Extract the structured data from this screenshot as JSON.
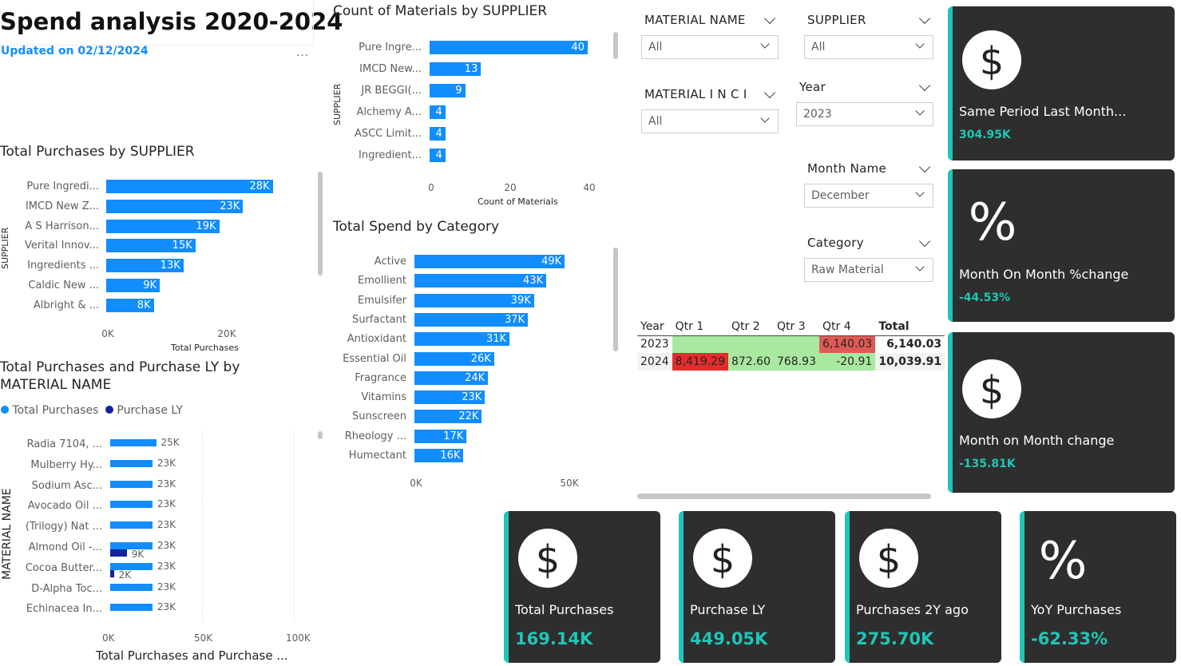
{
  "header": {
    "title": "Spend analysis 2020-2024",
    "updated": "Updated on 02/12/2024",
    "more": "..."
  },
  "count_materials": {
    "title": "Count of Materials by SUPPLIER",
    "y_title": "SUPPLIER",
    "x_title": "Count of Materials",
    "categories": [
      "Pure Ingre...",
      "IMCD New...",
      "JR BEGGI(...",
      "Alchemy A...",
      "ASCC Limit...",
      "Ingredient..."
    ],
    "values": [
      40,
      13,
      9,
      4,
      4,
      4
    ],
    "labels": [
      "40",
      "13",
      "9",
      "4",
      "4",
      "4"
    ],
    "ticks": [
      "0",
      "20",
      "40"
    ]
  },
  "total_purchases_supplier": {
    "title": "Total Purchases by SUPPLIER",
    "y_title": "SUPPLIER",
    "x_title": "Total Purchases",
    "categories": [
      "Pure Ingredi...",
      "IMCD New Z...",
      "A S Harrison...",
      "Verital Innov...",
      "Ingredients ...",
      "Caldic New ...",
      "Albright & ..."
    ],
    "values": [
      28,
      23,
      19,
      15,
      13,
      9,
      8
    ],
    "labels": [
      "28K",
      "23K",
      "19K",
      "15K",
      "13K",
      "9K",
      "8K"
    ],
    "ticks": [
      "0K",
      "20K"
    ]
  },
  "spend_category": {
    "title": "Total Spend by Category",
    "categories": [
      "Active",
      "Emollient",
      "Emulsifer",
      "Surfactant",
      "Antioxidant",
      "Essential Oil",
      "Fragrance",
      "Vitamins",
      "Sunscreen",
      "Rheology ...",
      "Humectant"
    ],
    "values": [
      49,
      43,
      39,
      37,
      31,
      26,
      24,
      23,
      22,
      17,
      16
    ],
    "labels": [
      "49K",
      "43K",
      "39K",
      "37K",
      "31K",
      "26K",
      "24K",
      "23K",
      "22K",
      "17K",
      "16K"
    ],
    "ticks": [
      "0K",
      "50K"
    ]
  },
  "purchases_ly": {
    "title": "Total Purchases and Purchase LY by MATERIAL NAME",
    "legend": [
      {
        "name": "Total Purchases",
        "color": "#118DFF"
      },
      {
        "name": "Purchase LY",
        "color": "#12239E"
      }
    ],
    "y_title": "MATERIAL NAME",
    "x_title": "Total Purchases and Purchase ...",
    "categories": [
      "Radia 7104, ...",
      "Mulberry Hy...",
      "Sodium Asc...",
      "Avocado Oil ...",
      "(Trilogy) Nat ...",
      "Almond Oil -...",
      "Cocoa Butter...",
      "D-Alpha Toc...",
      "Echinacea In..."
    ],
    "series_total": [
      25,
      23,
      23,
      23,
      23,
      23,
      23,
      23,
      23
    ],
    "series_ly": [
      0,
      0,
      0,
      0,
      0,
      9,
      2,
      0,
      0
    ],
    "total_labels": [
      "25K",
      "23K",
      "23K",
      "23K",
      "23K",
      "23K",
      "23K",
      "23K",
      "23K"
    ],
    "ly_labels": [
      "",
      "",
      "",
      "",
      "",
      "9K",
      "2K",
      "",
      ""
    ],
    "ticks": [
      "0K",
      "50K",
      "100K"
    ]
  },
  "slicers": {
    "material_name": {
      "title": "MATERIAL NAME",
      "value": "All"
    },
    "supplier": {
      "title": "SUPPLIER",
      "value": "All"
    },
    "material_inci": {
      "title": "MATERIAL I N C I",
      "value": "All"
    },
    "year": {
      "title": "Year",
      "value": "2023"
    },
    "month": {
      "title": "Month Name",
      "value": "December"
    },
    "category": {
      "title": "Category",
      "value": "Raw Material"
    }
  },
  "matrix": {
    "headers": [
      "Year",
      "Qtr 1",
      "Qtr 2",
      "Qtr 3",
      "Qtr 4",
      "Total"
    ],
    "rows": [
      {
        "year": "2023",
        "q1": "",
        "q2": "",
        "q3": "",
        "q4": "6,140.03",
        "total": "6,140.03"
      },
      {
        "year": "2024",
        "q1": "8,419.29",
        "q2": "872.60",
        "q3": "768.93",
        "q4": "-20.91",
        "total": "10,039.91"
      }
    ]
  },
  "cards_right": [
    {
      "icon": "dollar",
      "label": "Same Period Last Month...",
      "value": "304.95K"
    },
    {
      "icon": "percent",
      "label": "Month On Month %change",
      "value": "-44.53%"
    },
    {
      "icon": "dollar",
      "label": "Month on Month change",
      "value": "-135.81K"
    }
  ],
  "cards_bottom": [
    {
      "icon": "dollar",
      "label": "Total Purchases",
      "value": "169.14K"
    },
    {
      "icon": "dollar",
      "label": "Purchase LY",
      "value": "449.05K"
    },
    {
      "icon": "dollar",
      "label": "Purchases 2Y ago",
      "value": "275.70K"
    },
    {
      "icon": "percent",
      "label": "YoY Purchases",
      "value": "-62.33%"
    }
  ],
  "colors": {
    "bar": "#118DFF",
    "bar_dark": "#12239E",
    "card_bg": "#2E2E2E",
    "accent": "#1FC6B7",
    "green": "#A9E8A0",
    "red": "#E05A55"
  }
}
